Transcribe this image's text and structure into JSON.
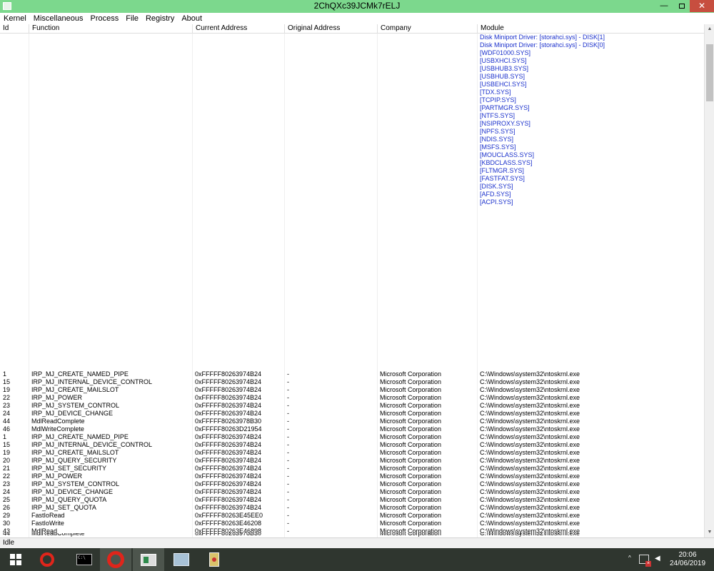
{
  "window": {
    "title": "2ChQXc39JCMk7rELJ",
    "minimize": "—",
    "close": "✕"
  },
  "menu": [
    "Kernel",
    "Miscellaneous",
    "Process",
    "File",
    "Registry",
    "About"
  ],
  "columns": [
    "Id",
    "Function",
    "Current Address",
    "Original Address",
    "Company",
    "Module"
  ],
  "module_links": [
    "Disk Miniport Driver: [storahci.sys] - DISK[1]",
    "Disk Miniport Driver: [storahci.sys] - DISK[0]",
    "[WDF01000.SYS]",
    "[USBXHCI.SYS]",
    "[USBHUB3.SYS]",
    "[USBHUB.SYS]",
    "[USBEHCI.SYS]",
    "[TDX.SYS]",
    "[TCPIP.SYS]",
    "[PARTMGR.SYS]",
    "[NTFS.SYS]",
    "[NSIPROXY.SYS]",
    "[NPFS.SYS]",
    "[NDIS.SYS]",
    "[MSFS.SYS]",
    "[MOUCLASS.SYS]",
    "[KBDCLASS.SYS]",
    "[FLTMGR.SYS]",
    "[FASTFAT.SYS]",
    "[DISK.SYS]",
    "[AFD.SYS]",
    "[ACPI.SYS]"
  ],
  "rows": [
    {
      "id": "1",
      "function": "IRP_MJ_CREATE_NAMED_PIPE",
      "current": "0xFFFFF80263974B24",
      "original": "-",
      "company": "Microsoft Corporation",
      "module": "C:\\Windows\\system32\\ntoskrnl.exe"
    },
    {
      "id": "15",
      "function": "IRP_MJ_INTERNAL_DEVICE_CONTROL",
      "current": "0xFFFFF80263974B24",
      "original": "-",
      "company": "Microsoft Corporation",
      "module": "C:\\Windows\\system32\\ntoskrnl.exe"
    },
    {
      "id": "19",
      "function": "IRP_MJ_CREATE_MAILSLOT",
      "current": "0xFFFFF80263974B24",
      "original": "-",
      "company": "Microsoft Corporation",
      "module": "C:\\Windows\\system32\\ntoskrnl.exe"
    },
    {
      "id": "22",
      "function": "IRP_MJ_POWER",
      "current": "0xFFFFF80263974B24",
      "original": "-",
      "company": "Microsoft Corporation",
      "module": "C:\\Windows\\system32\\ntoskrnl.exe"
    },
    {
      "id": "23",
      "function": "IRP_MJ_SYSTEM_CONTROL",
      "current": "0xFFFFF80263974B24",
      "original": "-",
      "company": "Microsoft Corporation",
      "module": "C:\\Windows\\system32\\ntoskrnl.exe"
    },
    {
      "id": "24",
      "function": "IRP_MJ_DEVICE_CHANGE",
      "current": "0xFFFFF80263974B24",
      "original": "-",
      "company": "Microsoft Corporation",
      "module": "C:\\Windows\\system32\\ntoskrnl.exe"
    },
    {
      "id": "44",
      "function": "MdlReadComplete",
      "current": "0xFFFFF80263978B30",
      "original": "-",
      "company": "Microsoft Corporation",
      "module": "C:\\Windows\\system32\\ntoskrnl.exe"
    },
    {
      "id": "46",
      "function": "MdlWriteComplete",
      "current": "0xFFFFF80263D21954",
      "original": "-",
      "company": "Microsoft Corporation",
      "module": "C:\\Windows\\system32\\ntoskrnl.exe"
    },
    {
      "id": "1",
      "function": "IRP_MJ_CREATE_NAMED_PIPE",
      "current": "0xFFFFF80263974B24",
      "original": "-",
      "company": "Microsoft Corporation",
      "module": "C:\\Windows\\system32\\ntoskrnl.exe"
    },
    {
      "id": "15",
      "function": "IRP_MJ_INTERNAL_DEVICE_CONTROL",
      "current": "0xFFFFF80263974B24",
      "original": "-",
      "company": "Microsoft Corporation",
      "module": "C:\\Windows\\system32\\ntoskrnl.exe"
    },
    {
      "id": "19",
      "function": "IRP_MJ_CREATE_MAILSLOT",
      "current": "0xFFFFF80263974B24",
      "original": "-",
      "company": "Microsoft Corporation",
      "module": "C:\\Windows\\system32\\ntoskrnl.exe"
    },
    {
      "id": "20",
      "function": "IRP_MJ_QUERY_SECURITY",
      "current": "0xFFFFF80263974B24",
      "original": "-",
      "company": "Microsoft Corporation",
      "module": "C:\\Windows\\system32\\ntoskrnl.exe"
    },
    {
      "id": "21",
      "function": "IRP_MJ_SET_SECURITY",
      "current": "0xFFFFF80263974B24",
      "original": "-",
      "company": "Microsoft Corporation",
      "module": "C:\\Windows\\system32\\ntoskrnl.exe"
    },
    {
      "id": "22",
      "function": "IRP_MJ_POWER",
      "current": "0xFFFFF80263974B24",
      "original": "-",
      "company": "Microsoft Corporation",
      "module": "C:\\Windows\\system32\\ntoskrnl.exe"
    },
    {
      "id": "23",
      "function": "IRP_MJ_SYSTEM_CONTROL",
      "current": "0xFFFFF80263974B24",
      "original": "-",
      "company": "Microsoft Corporation",
      "module": "C:\\Windows\\system32\\ntoskrnl.exe"
    },
    {
      "id": "24",
      "function": "IRP_MJ_DEVICE_CHANGE",
      "current": "0xFFFFF80263974B24",
      "original": "-",
      "company": "Microsoft Corporation",
      "module": "C:\\Windows\\system32\\ntoskrnl.exe"
    },
    {
      "id": "25",
      "function": "IRP_MJ_QUERY_QUOTA",
      "current": "0xFFFFF80263974B24",
      "original": "-",
      "company": "Microsoft Corporation",
      "module": "C:\\Windows\\system32\\ntoskrnl.exe"
    },
    {
      "id": "26",
      "function": "IRP_MJ_SET_QUOTA",
      "current": "0xFFFFF80263974B24",
      "original": "-",
      "company": "Microsoft Corporation",
      "module": "C:\\Windows\\system32\\ntoskrnl.exe"
    },
    {
      "id": "29",
      "function": "FastIoRead",
      "current": "0xFFFFF80263E45EE0",
      "original": "-",
      "company": "Microsoft Corporation",
      "module": "C:\\Windows\\system32\\ntoskrnl.exe"
    },
    {
      "id": "30",
      "function": "FastIoWrite",
      "current": "0xFFFFF80263E46208",
      "original": "-",
      "company": "Microsoft Corporation",
      "module": "C:\\Windows\\system32\\ntoskrnl.exe"
    },
    {
      "id": "43",
      "function": "MdlRead",
      "current": "0xFFFFF80263E46898",
      "original": "-",
      "company": "Microsoft Corporation",
      "module": "C:\\Windows\\system32\\ntoskrnl.exe"
    }
  ],
  "status": "Idle",
  "taskbar": {
    "cmd_label": "C:\\",
    "time": "20:06",
    "date": "24/06/2019",
    "tray_chevron": "^",
    "volume": "◀"
  },
  "icons": {
    "window_icon": "app-window-icon",
    "start": "windows-logo-icon",
    "browser": "opera-icon",
    "terminal": "command-prompt-icon",
    "monitor": "resource-monitor-icon",
    "power": "power-icon",
    "network": "network-disconnected-icon",
    "volume": "volume-icon"
  },
  "colors": {
    "titlebar": "#7cd88d",
    "link": "#1b31cc",
    "close": "#c74e3f",
    "taskbar": "#2f362f"
  }
}
